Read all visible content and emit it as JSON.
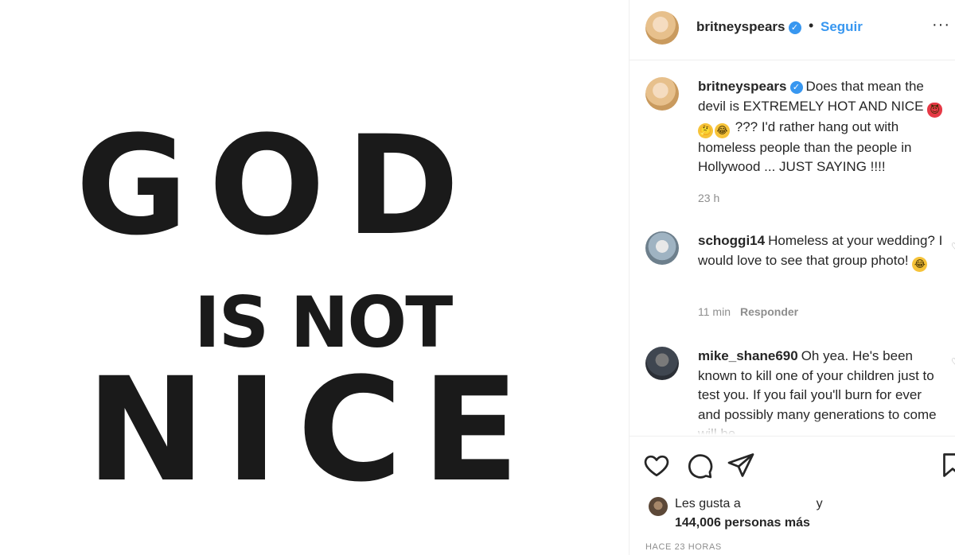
{
  "image": {
    "line1": "GOD",
    "line2": "IS NOT",
    "line3": "NICE"
  },
  "header": {
    "username": "britneyspears",
    "separator": "•",
    "follow_label": "Seguir",
    "more_icon": "more-horizontal-icon"
  },
  "caption": {
    "username": "britneyspears",
    "text_before_emoji": "Does that mean the devil is EXTREMELY HOT AND NICE",
    "text_after_emoji": "??? I'd rather hang out with homeless people than the people in Hollywood ... JUST SAYING !!!!",
    "time": "23 h"
  },
  "comments": [
    {
      "username": "schoggi14",
      "text": "Homeless at your wedding? I would love to see that group photo!",
      "time": "11 min",
      "reply_label": "Responder"
    },
    {
      "username": "mike_shane690",
      "text": "Oh yea. He's been known to kill one of your children just to test you. If you fail you'll burn for ever and possibly many generations to come will be"
    }
  ],
  "actions": {
    "like_icon": "heart-icon",
    "comment_icon": "comment-icon",
    "share_icon": "share-icon",
    "save_icon": "bookmark-icon"
  },
  "likes": {
    "prefix": "Les gusta a",
    "suffix": "y",
    "count_text": "144,006 personas más"
  },
  "timestamp": "HACE 23 HORAS",
  "colors": {
    "accent": "#3897f0",
    "text": "#262626",
    "muted": "#8e8e8e",
    "border": "#efefef"
  }
}
